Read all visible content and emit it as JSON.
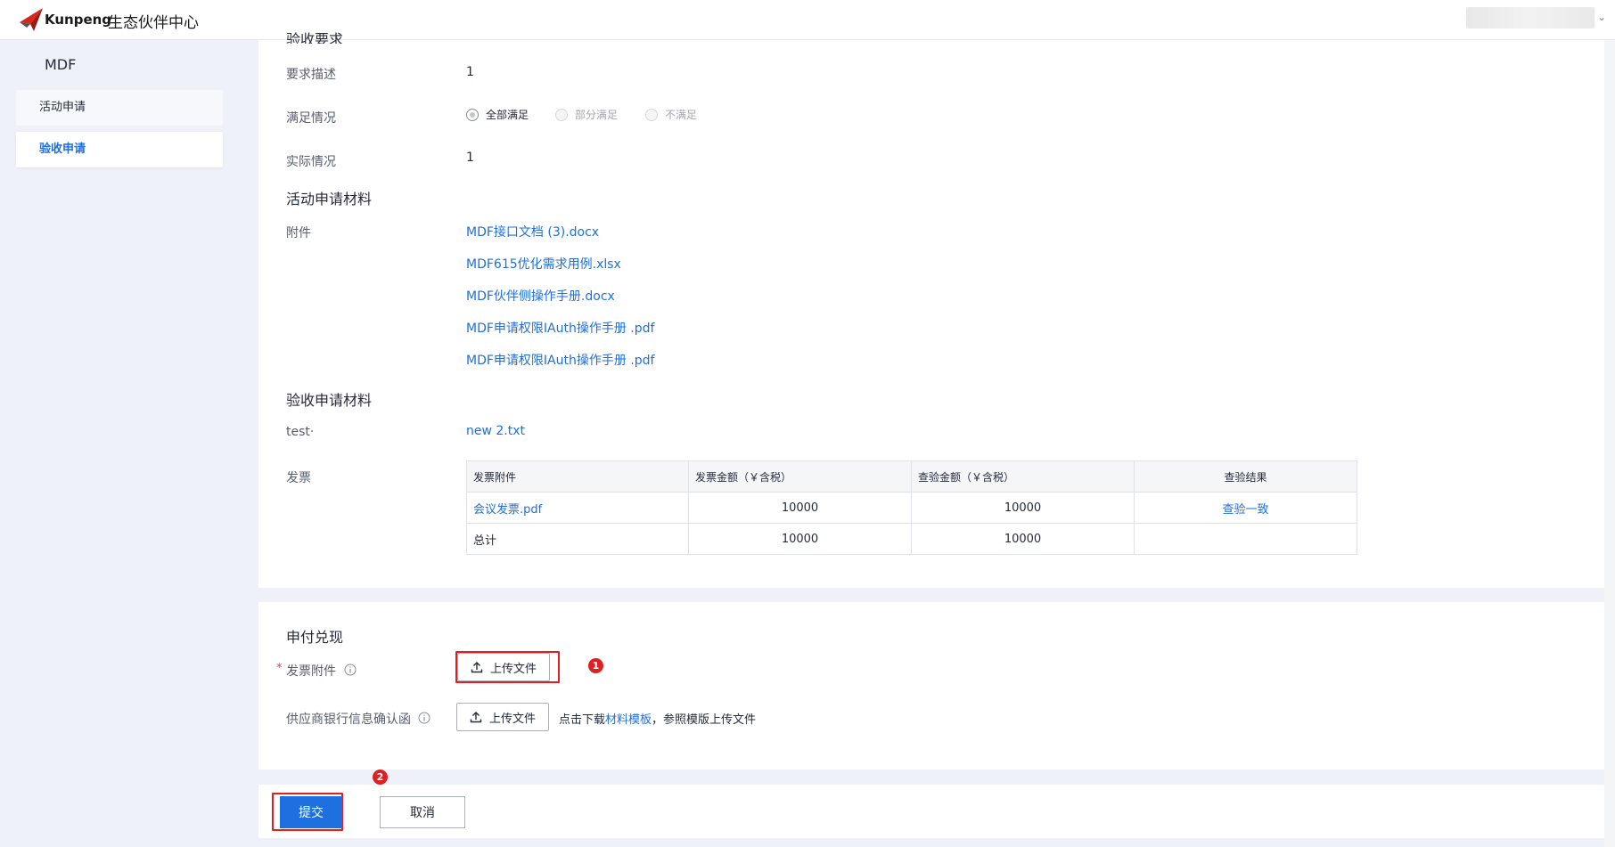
{
  "header": {
    "brand": "Kunpeng",
    "title": "生态伙伴中心"
  },
  "sidebar": {
    "title": "MDF",
    "items": [
      {
        "label": "活动申请"
      },
      {
        "label": "验收申请"
      }
    ]
  },
  "acceptance": {
    "section_title_partial": "验收要求",
    "desc_label": "要求描述",
    "desc_value": "1",
    "status_label": "满足情况",
    "radio_options": [
      "全部满足",
      "部分满足",
      "不满足"
    ],
    "actual_label": "实际情况",
    "actual_value": "1"
  },
  "activity_materials": {
    "title": "活动申请材料",
    "attach_label": "附件",
    "files": [
      "MDF接口文档 (3).docx",
      "MDF615优化需求用例.xlsx",
      "MDF伙伴侧操作手册.docx",
      "MDF申请权限IAuth操作手册 .pdf",
      "MDF申请权限IAuth操作手册 .pdf"
    ]
  },
  "acceptance_materials": {
    "title": "验收申请材料",
    "test_label": "test·",
    "test_file": "new 2.txt",
    "invoice_label": "发票",
    "table": {
      "headers": [
        "发票附件",
        "发票金额（￥含税）",
        "查验金额（￥含税）",
        "查验结果"
      ],
      "rows": [
        [
          "会议发票.pdf",
          "10000",
          "10000",
          "查验一致"
        ],
        [
          "总计",
          "10000",
          "10000",
          ""
        ]
      ]
    }
  },
  "payment": {
    "title": "申付兑现",
    "required_mark": "*",
    "invoice_attach_label": "发票附件",
    "upload_label": "上传文件",
    "bank_label": "供应商银行信息确认函",
    "hint_prefix": "点击下载",
    "hint_link": "材料模板",
    "hint_suffix": "，参照模版上传文件",
    "badge1": "1"
  },
  "footer": {
    "badge2": "2",
    "submit": "提交",
    "cancel": "取消"
  },
  "colors": {
    "accent": "#1e6fe0",
    "highlight": "#e02020",
    "background": "#eef1f7"
  }
}
